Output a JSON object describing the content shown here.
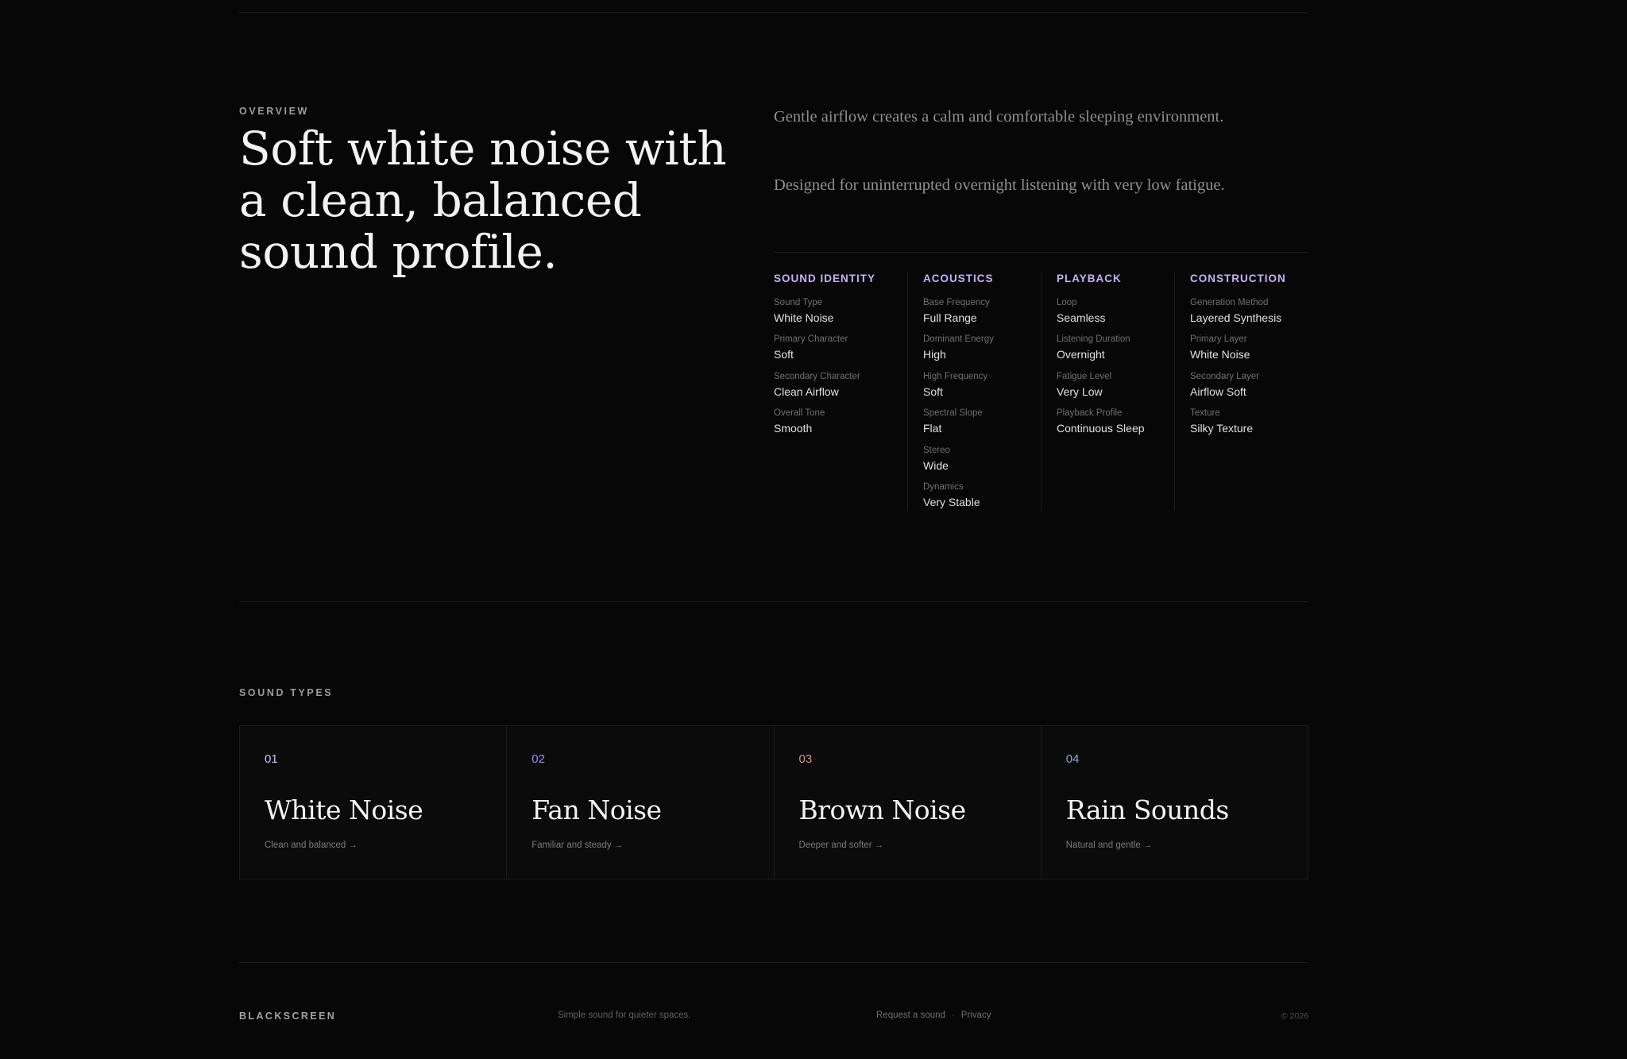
{
  "overview": {
    "eyebrow": "OVERVIEW",
    "headline": "Soft white noise with a clean, balanced sound profile.",
    "intro": [
      "Gentle airflow creates a calm and comfortable sleeping environment.",
      "Designed for uninterrupted overnight listening with very low fatigue."
    ]
  },
  "specs": [
    {
      "heading": "SOUND IDENTITY",
      "items": [
        {
          "label": "Sound Type",
          "value": "White Noise"
        },
        {
          "label": "Primary Character",
          "value": "Soft"
        },
        {
          "label": "Secondary Character",
          "value": "Clean Airflow"
        },
        {
          "label": "Overall Tone",
          "value": "Smooth"
        }
      ]
    },
    {
      "heading": "ACOUSTICS",
      "items": [
        {
          "label": "Base Frequency",
          "value": "Full Range"
        },
        {
          "label": "Dominant Energy",
          "value": "High"
        },
        {
          "label": "High Frequency",
          "value": "Soft"
        },
        {
          "label": "Spectral Slope",
          "value": "Flat"
        },
        {
          "label": "Stereo",
          "value": "Wide"
        },
        {
          "label": "Dynamics",
          "value": "Very Stable"
        }
      ]
    },
    {
      "heading": "PLAYBACK",
      "items": [
        {
          "label": "Loop",
          "value": "Seamless"
        },
        {
          "label": "Listening Duration",
          "value": "Overnight"
        },
        {
          "label": "Fatigue Level",
          "value": "Very Low"
        },
        {
          "label": "Playback Profile",
          "value": "Continuous Sleep"
        }
      ]
    },
    {
      "heading": "CONSTRUCTION",
      "items": [
        {
          "label": "Generation Method",
          "value": "Layered Synthesis"
        },
        {
          "label": "Primary Layer",
          "value": "White Noise"
        },
        {
          "label": "Secondary Layer",
          "value": "Airflow Soft"
        },
        {
          "label": "Texture",
          "value": "Silky Texture"
        }
      ]
    }
  ],
  "sound_types": {
    "eyebrow": "SOUND TYPES",
    "cards": [
      {
        "number": "01",
        "title": "White Noise",
        "subtitle": "Clean and balanced →",
        "number_color": "#c9c7ef"
      },
      {
        "number": "02",
        "title": "Fan Noise",
        "subtitle": "Familiar and steady →",
        "number_color": "#a58af0"
      },
      {
        "number": "03",
        "title": "Brown Noise",
        "subtitle": "Deeper and softer →",
        "number_color": "#c79a80"
      },
      {
        "number": "04",
        "title": "Rain Sounds",
        "subtitle": "Natural and gentle →",
        "number_color": "#86a8d8"
      }
    ]
  },
  "footer": {
    "brand": "BLACKSCREEN",
    "tagline": "Simple sound for quieter spaces.",
    "links": [
      "Request a sound",
      "Privacy"
    ],
    "separator": "·",
    "copyright": "© 2026"
  }
}
